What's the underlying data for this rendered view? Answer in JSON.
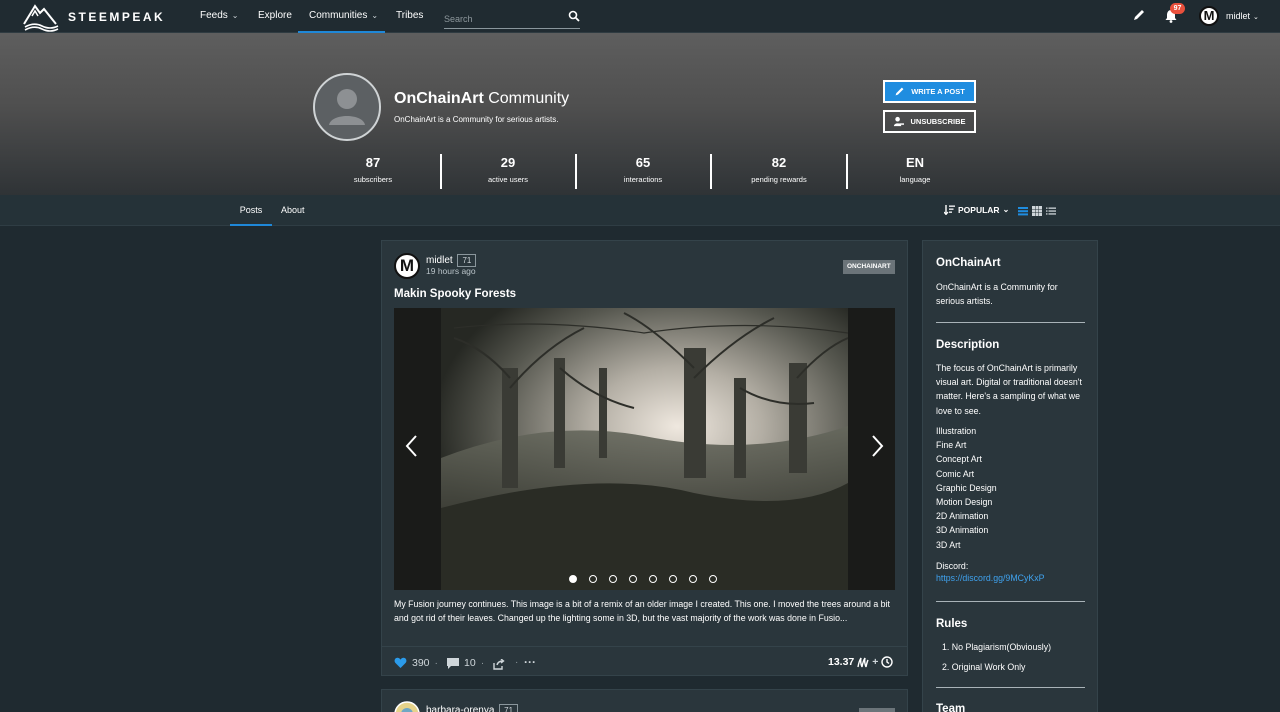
{
  "nav": {
    "brand": "STEEMPEAK",
    "feeds": "Feeds",
    "explore": "Explore",
    "communities": "Communities",
    "tribes": "Tribes",
    "search_placeholder": "Search",
    "notification_count": "97",
    "user_avatar_letter": "M",
    "username": "midlet"
  },
  "community": {
    "title_bold": "OnChainArt",
    "title_rest": " Community",
    "tagline": "OnChainArt is a Community for serious artists.",
    "write_post": "WRITE A POST",
    "unsubscribe": "UNSUBSCRIBE",
    "stats": [
      {
        "value": "87",
        "label": "subscribers"
      },
      {
        "value": "29",
        "label": "active users"
      },
      {
        "value": "65",
        "label": "interactions"
      },
      {
        "value": "82",
        "label": "pending rewards"
      },
      {
        "value": "EN",
        "label": "language"
      }
    ]
  },
  "tabs": {
    "posts": "Posts",
    "about": "About",
    "sort": "POPULAR"
  },
  "post": {
    "avatar_letter": "M",
    "author": "midlet",
    "reputation": "71",
    "time": "19 hours ago",
    "tag": "ONCHAINART",
    "title": "Makin Spooky Forests",
    "excerpt": "My Fusion journey continues. This image is a bit of a remix of an older image I created. This one. I moved the trees around a bit and got rid of their leaves. Changed up the lighting some in 3D, but the vast majority of the work was done in Fusio...",
    "votes": "390",
    "comments": "10",
    "payout": "13.37",
    "carousel_active": 0,
    "carousel_count": 8
  },
  "post2": {
    "author": "barbara-orenya",
    "reputation": "71"
  },
  "sidebar": {
    "name": "OnChainArt",
    "about": "OnChainArt is a Community for serious artists.",
    "description_heading": "Description",
    "description": "The focus of OnChainArt is primarily visual art. Digital or traditional doesn't matter. Here's a sampling of what we love to see.",
    "categories": [
      "Illustration",
      "Fine Art",
      "Concept Art",
      "Comic Art",
      "Graphic Design",
      "Motion Design",
      "2D Animation",
      "3D Animation",
      "3D Art"
    ],
    "discord_label": "Discord:",
    "discord_link": "https://discord.gg/9MCyKxP",
    "rules_heading": "Rules",
    "rules": [
      "1. No Plagiarism(Obviously)",
      "2. Original Work Only"
    ],
    "team_heading": "Team"
  }
}
